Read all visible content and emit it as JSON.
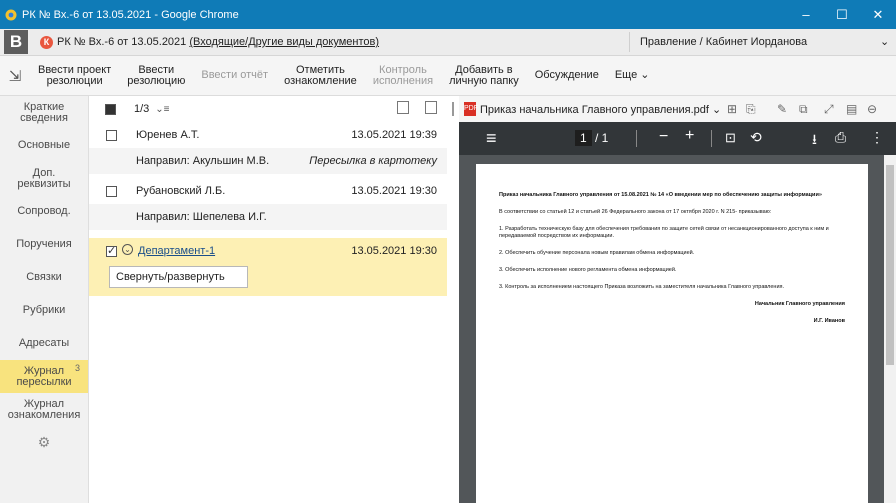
{
  "window": {
    "title": "РК № Вх.-6 от 13.05.2021 - Google Chrome",
    "controls": [
      "‒",
      "☐",
      "✕"
    ]
  },
  "addr": {
    "logo": "B",
    "badge": "К",
    "doc_title": "РК № Вх.-6 от 13.05.2021",
    "link": "(Входящие/Другие виды документов)",
    "user": "Правление / Кабинет Иорданова"
  },
  "toolbar": {
    "items": [
      {
        "label": "Ввести проект\nрезолюции",
        "disabled": false
      },
      {
        "label": "Ввести\nрезолюцию",
        "disabled": false
      },
      {
        "label": "Ввести отчёт",
        "disabled": true
      },
      {
        "label": "Отметить\nознакомление",
        "disabled": false
      },
      {
        "label": "Контроль\nисполнения",
        "disabled": true
      },
      {
        "label": "Добавить в\nличную папку",
        "disabled": false
      },
      {
        "label": "Обсуждение",
        "disabled": false
      },
      {
        "label": "Еще",
        "disabled": false
      }
    ]
  },
  "sidebar": {
    "items": [
      {
        "label": "Краткие\nсведения"
      },
      {
        "label": "Основные"
      },
      {
        "label": "Доп.\nреквизиты"
      },
      {
        "label": "Сопровод."
      },
      {
        "label": "Поручения"
      },
      {
        "label": "Связки"
      },
      {
        "label": "Рубрики"
      },
      {
        "label": "Адресаты"
      },
      {
        "label": "Журнал\nпересылки",
        "count": "3",
        "active": true
      },
      {
        "label": "Журнал\nознакомления"
      }
    ]
  },
  "list": {
    "counter": "1/3",
    "sort": "⌄≡",
    "rows": [
      {
        "name": "Юренев А.Т.",
        "date": "13.05.2021 19:39",
        "sub": "Направил: Акульшин М.В.",
        "sub_right": "Пересылка в картотеку"
      },
      {
        "name": "Рубановский Л.Б.",
        "date": "13.05.2021 19:30",
        "sub": "Направил: Шепелева И.Г.",
        "sub_right": ""
      },
      {
        "name": "Департамент-1",
        "date": "13.05.2021 19:30"
      }
    ],
    "tooltip": "Свернуть/развернуть"
  },
  "viewer": {
    "file": "Приказ начальника Главного управления.pdf ⌄",
    "page_current": "1",
    "page_total": "/ 1",
    "doc": {
      "title": "Приказ начальника Главного управления от 15.08.2021 № 14 «О введении мер по обеспечению защиты информации»",
      "intro": "В соответствии со статьей 12 и статьей 26 Федерального закона от 17 октября 2020 г. N 215- приказываю:",
      "p1": "1. Разработать техническую базу для обеспечения требования по защите сетей связи от несанкционированного доступа к ним и передаваемой посредством их информации.",
      "p2": "2. Обеспечить обучение персонала новым правилам обмена информацией.",
      "p3": "3. Обеспечить исполнение нового регламента обмена информацией.",
      "p4": "3. Контроль за исполнением настоящего Приказа возложить на заместителя начальника Главного управления.",
      "sig1": "Начальник Главного управления",
      "sig2": "И.Г. Иванов"
    }
  }
}
